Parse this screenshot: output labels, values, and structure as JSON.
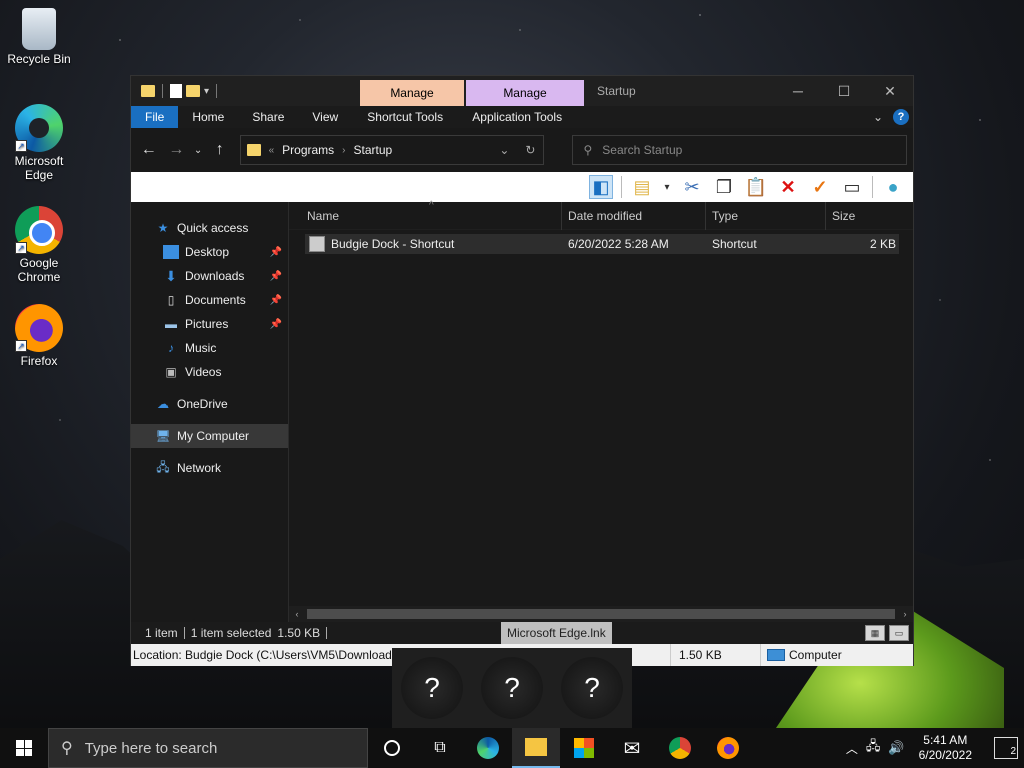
{
  "desktop": {
    "icons": [
      {
        "label": "Recycle Bin"
      },
      {
        "label": "Microsoft Edge"
      },
      {
        "label": "Google Chrome"
      },
      {
        "label": "Firefox"
      }
    ]
  },
  "window": {
    "context_tabs": [
      "Manage",
      "Manage"
    ],
    "title": "Startup",
    "controls": {
      "minimize": "─",
      "maximize": "☐",
      "close": "✕"
    }
  },
  "ribbon": {
    "tabs": [
      "File",
      "Home",
      "Share",
      "View",
      "Shortcut Tools",
      "Application Tools"
    ],
    "help": "?"
  },
  "address": {
    "crumbs": [
      "Programs",
      "Startup"
    ],
    "overflow": "«",
    "search_placeholder": "Search Startup"
  },
  "nav": {
    "items": [
      {
        "label": "Quick access",
        "icon": "star-icon",
        "level": 0
      },
      {
        "label": "Desktop",
        "icon": "desktop-icon",
        "level": 1,
        "pinned": true
      },
      {
        "label": "Downloads",
        "icon": "download-icon",
        "level": 1,
        "pinned": true
      },
      {
        "label": "Documents",
        "icon": "document-icon",
        "level": 1,
        "pinned": true
      },
      {
        "label": "Pictures",
        "icon": "picture-icon",
        "level": 1,
        "pinned": true
      },
      {
        "label": "Music",
        "icon": "music-icon",
        "level": 1
      },
      {
        "label": "Videos",
        "icon": "video-icon",
        "level": 1
      },
      {
        "label": "OneDrive",
        "icon": "cloud-icon",
        "level": 0
      },
      {
        "label": "My Computer",
        "icon": "computer-icon",
        "level": 0,
        "selected": true
      },
      {
        "label": "Network",
        "icon": "network-icon",
        "level": 0
      }
    ]
  },
  "list": {
    "columns": [
      "Name",
      "Date modified",
      "Type",
      "Size"
    ],
    "rows": [
      {
        "name": "Budgie Dock - Shortcut",
        "date": "6/20/2022 5:28 AM",
        "type": "Shortcut",
        "size": "2 KB"
      }
    ]
  },
  "status": {
    "count": "1 item",
    "selected": "1 item selected",
    "selected_size": "1.50 KB",
    "tooltip": "Microsoft Edge.lnk",
    "location": "Location: Budgie Dock (C:\\Users\\VM5\\Downloads)",
    "size": "1.50 KB",
    "zone": "Computer"
  },
  "thumbnails": [
    "?",
    "?",
    "?"
  ],
  "taskbar": {
    "search_placeholder": "Type here to search",
    "time": "5:41 AM",
    "date": "6/20/2022",
    "notifications": "2"
  },
  "colors": {
    "accent": "#1a6fc1",
    "manage1": "#f6c6a8",
    "manage2": "#d9b8f0"
  }
}
